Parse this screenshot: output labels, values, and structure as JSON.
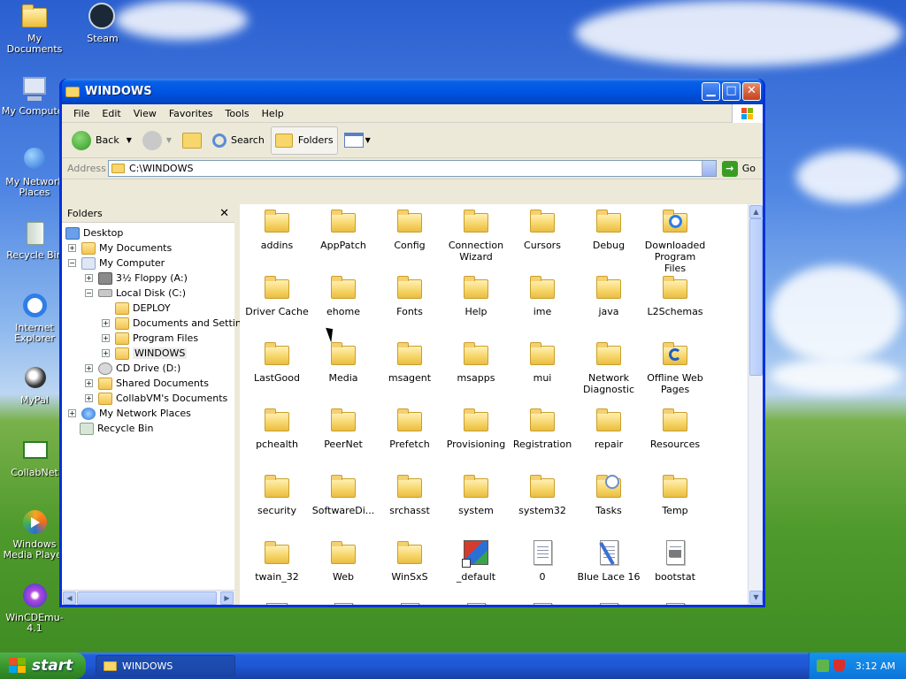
{
  "desktop": {
    "icons": [
      {
        "label": "My Documents"
      },
      {
        "label": "Steam"
      },
      {
        "label": "My Computer"
      },
      {
        "label": "My Network Places"
      },
      {
        "label": "Recycle Bin"
      },
      {
        "label": "Internet Explorer"
      },
      {
        "label": "MyPal"
      },
      {
        "label": "CollabNet"
      },
      {
        "label": "Windows Media Player"
      },
      {
        "label": "WinCDEmu-4.1"
      }
    ]
  },
  "window": {
    "title": "WINDOWS",
    "menu": [
      "File",
      "Edit",
      "View",
      "Favorites",
      "Tools",
      "Help"
    ],
    "toolbar": {
      "back": "Back",
      "search": "Search",
      "folders": "Folders"
    },
    "address": {
      "label": "Address",
      "value": "C:\\WINDOWS",
      "go": "Go"
    },
    "folders_pane": {
      "title": "Folders",
      "tree": [
        "Desktop",
        "My Documents",
        "My Computer",
        "3½ Floppy (A:)",
        "Local Disk (C:)",
        "DEPLOY",
        "Documents and Settings",
        "Program Files",
        "WINDOWS",
        "CD Drive (D:)",
        "Shared Documents",
        "CollabVM's Documents",
        "My Network Places",
        "Recycle Bin"
      ]
    },
    "items": [
      {
        "label": "addins",
        "icon": "folder"
      },
      {
        "label": "AppPatch",
        "icon": "folder"
      },
      {
        "label": "Config",
        "icon": "folder"
      },
      {
        "label": "Connection Wizard",
        "icon": "folder"
      },
      {
        "label": "Cursors",
        "icon": "folder"
      },
      {
        "label": "Debug",
        "icon": "folder"
      },
      {
        "label": "Downloaded Program Files",
        "icon": "ie-folder"
      },
      {
        "label": "Driver Cache",
        "icon": "folder"
      },
      {
        "label": "ehome",
        "icon": "folder"
      },
      {
        "label": "Fonts",
        "icon": "folder"
      },
      {
        "label": "Help",
        "icon": "folder"
      },
      {
        "label": "ime",
        "icon": "folder"
      },
      {
        "label": "java",
        "icon": "folder"
      },
      {
        "label": "L2Schemas",
        "icon": "folder"
      },
      {
        "label": "LastGood",
        "icon": "folder"
      },
      {
        "label": "Media",
        "icon": "folder"
      },
      {
        "label": "msagent",
        "icon": "folder"
      },
      {
        "label": "msapps",
        "icon": "folder"
      },
      {
        "label": "mui",
        "icon": "folder"
      },
      {
        "label": "Network Diagnostic",
        "icon": "folder"
      },
      {
        "label": "Offline Web Pages",
        "icon": "sync-folder"
      },
      {
        "label": "pchealth",
        "icon": "folder"
      },
      {
        "label": "PeerNet",
        "icon": "folder"
      },
      {
        "label": "Prefetch",
        "icon": "folder"
      },
      {
        "label": "Provisioning",
        "icon": "folder"
      },
      {
        "label": "Registration",
        "icon": "folder"
      },
      {
        "label": "repair",
        "icon": "folder"
      },
      {
        "label": "Resources",
        "icon": "folder"
      },
      {
        "label": "security",
        "icon": "folder"
      },
      {
        "label": "SoftwareDi...",
        "icon": "folder"
      },
      {
        "label": "srchasst",
        "icon": "folder"
      },
      {
        "label": "system",
        "icon": "folder"
      },
      {
        "label": "system32",
        "icon": "folder"
      },
      {
        "label": "Tasks",
        "icon": "tasks-folder"
      },
      {
        "label": "Temp",
        "icon": "folder"
      },
      {
        "label": "twain_32",
        "icon": "folder"
      },
      {
        "label": "Web",
        "icon": "folder"
      },
      {
        "label": "WinSxS",
        "icon": "folder"
      },
      {
        "label": "_default",
        "icon": "msdos-shortcut"
      },
      {
        "label": "0",
        "icon": "document"
      },
      {
        "label": "Blue Lace 16",
        "icon": "bitmap"
      },
      {
        "label": "bootstat",
        "icon": "data-file"
      },
      {
        "label": "",
        "icon": "media-file"
      },
      {
        "label": "",
        "icon": "document"
      },
      {
        "label": "",
        "icon": "bitmap"
      },
      {
        "label": "",
        "icon": "document"
      },
      {
        "label": "",
        "icon": "config-file"
      },
      {
        "label": "",
        "icon": "config-file"
      },
      {
        "label": "",
        "icon": "document"
      }
    ]
  },
  "taskbar": {
    "start": "start",
    "task": "WINDOWS",
    "clock": "3:12 AM"
  }
}
